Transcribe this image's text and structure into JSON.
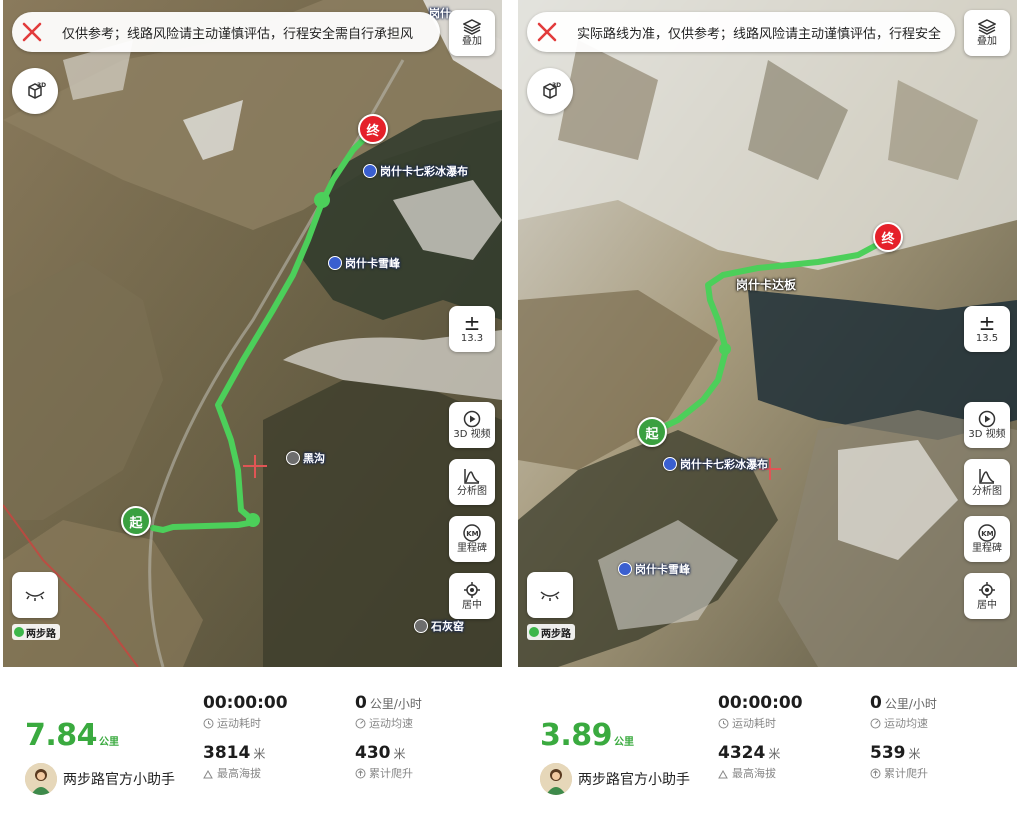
{
  "panels": [
    {
      "notice": "仅供参考；线路风险请主动谨慎评估，行程安全需自行承担风",
      "layers_label": "叠加",
      "zoom": "13.3",
      "video_label": "3D 视频",
      "analysis_label": "分析图",
      "milestone_label": "里程碑",
      "center_label": "居中",
      "logo": "两步路",
      "start_marker": "起",
      "end_marker": "终",
      "pois": [
        "岗什卡七彩冰瀑布",
        "岗什卡雪峰",
        "黑沟",
        "石灰窑"
      ],
      "top_corner_text": "岗什",
      "distance": "7.84",
      "distance_unit": "公里",
      "user_name": "两步路官方小助手",
      "duration": "00:00:00",
      "duration_label": "运动耗时",
      "speed": "0",
      "speed_unit": "公里/小时",
      "speed_label": "运动均速",
      "max_alt": "3814",
      "max_alt_unit": "米",
      "max_alt_label": "最高海拔",
      "climb": "430",
      "climb_unit": "米",
      "climb_label": "累计爬升"
    },
    {
      "notice": "实际路线为准，仅供参考；线路风险请主动谨慎评估，行程安全",
      "layers_label": "叠加",
      "zoom": "13.5",
      "video_label": "3D 视频",
      "analysis_label": "分析图",
      "milestone_label": "里程碑",
      "center_label": "居中",
      "logo": "两步路",
      "start_marker": "起",
      "end_marker": "终",
      "pass_label": "岗什卡达板",
      "pois": [
        "岗什卡七彩冰瀑布",
        "岗什卡雪峰"
      ],
      "distance": "3.89",
      "distance_unit": "公里",
      "user_name": "两步路官方小助手",
      "duration": "00:00:00",
      "duration_label": "运动耗时",
      "speed": "0",
      "speed_unit": "公里/小时",
      "speed_label": "运动均速",
      "max_alt": "4324",
      "max_alt_unit": "米",
      "max_alt_label": "最高海拔",
      "climb": "539",
      "climb_unit": "米",
      "climb_label": "累计爬升"
    }
  ],
  "colors": {
    "route": "#4ccf5a",
    "accent_green": "#3aaa3f",
    "end_red": "#e5202a",
    "start_green": "#3aa040"
  }
}
